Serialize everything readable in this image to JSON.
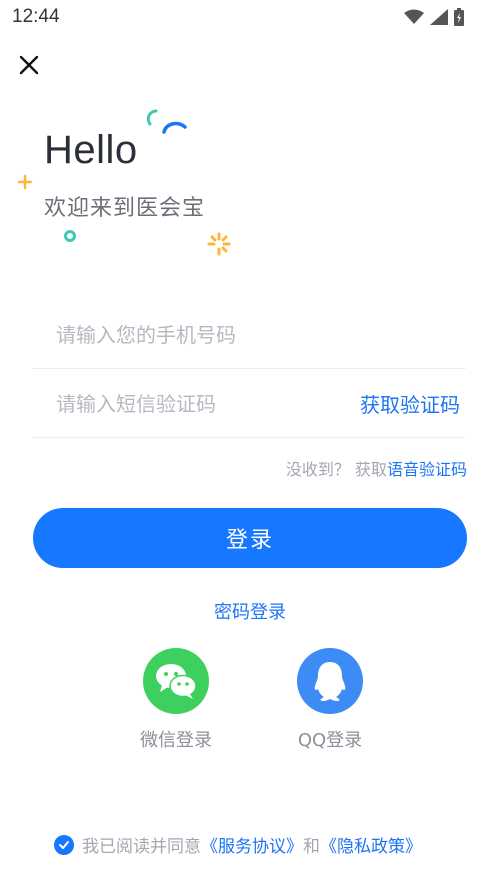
{
  "status_bar": {
    "time": "12:44"
  },
  "header": {
    "close_icon": "close-icon"
  },
  "greeting": {
    "title": "Hello",
    "subtitle": "欢迎来到医会宝"
  },
  "form": {
    "phone_placeholder": "请输入您的手机号码",
    "code_placeholder": "请输入短信验证码",
    "get_code_label": "获取验证码",
    "not_received": "没收到？ 获取",
    "voice_code_label": "语音验证码"
  },
  "login_button": "登录",
  "password_login": "密码登录",
  "social": {
    "wechat_label": "微信登录",
    "qq_label": "QQ登录"
  },
  "agreement": {
    "prefix": "我已阅读并同意",
    "service": "《服务协议》",
    "and": "和",
    "privacy": "《隐私政策》"
  },
  "colors": {
    "accent": "#1677ff",
    "wechat": "#3dd05f",
    "qq": "#3d8cf5"
  }
}
